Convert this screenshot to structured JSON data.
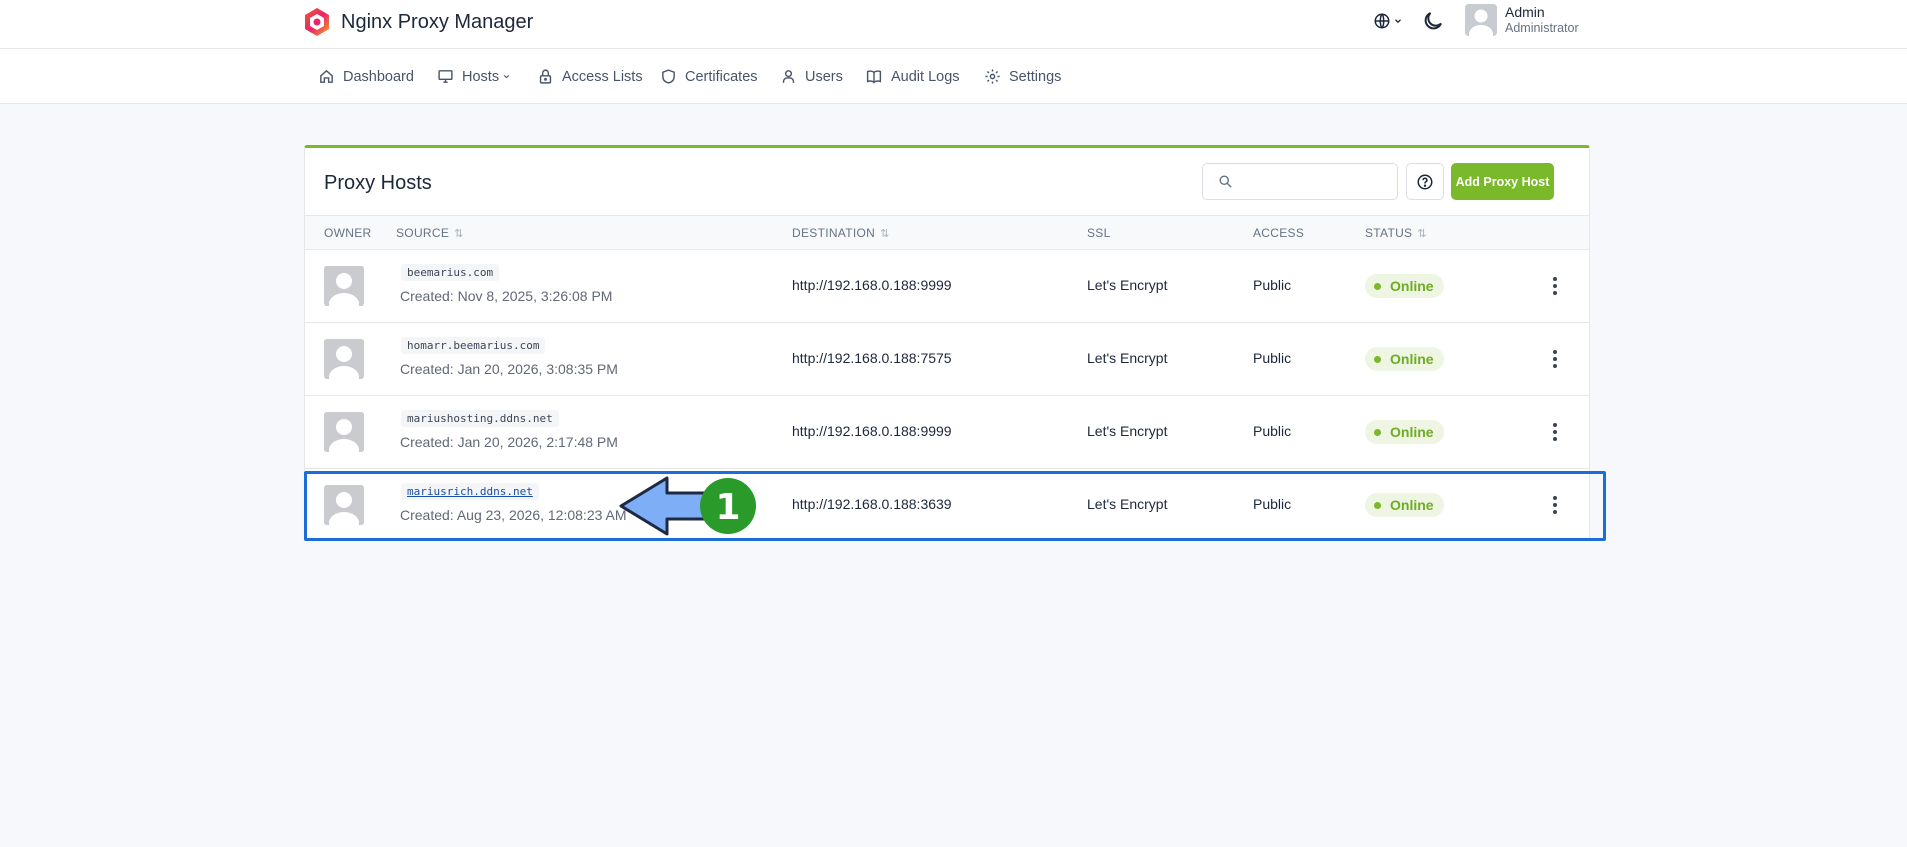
{
  "app": {
    "title": "Nginx Proxy Manager"
  },
  "user": {
    "name": "Admin",
    "role": "Administrator"
  },
  "nav": [
    {
      "label": "Dashboard",
      "icon": "home-icon"
    },
    {
      "label": "Hosts",
      "icon": "monitor-icon"
    },
    {
      "label": "Access Lists",
      "icon": "lock-icon"
    },
    {
      "label": "Certificates",
      "icon": "shield-icon"
    },
    {
      "label": "Users",
      "icon": "user-icon"
    },
    {
      "label": "Audit Logs",
      "icon": "book-icon"
    },
    {
      "label": "Settings",
      "icon": "gear-icon"
    }
  ],
  "card": {
    "title": "Proxy Hosts",
    "search_placeholder": "",
    "add_button": "Add Proxy Host"
  },
  "columns": {
    "owner": "OWNER",
    "source": "SOURCE",
    "destination": "DESTINATION",
    "ssl": "SSL",
    "access": "ACCESS",
    "status": "STATUS"
  },
  "rows": [
    {
      "domain": "beemarius.com",
      "created": "Created: Nov 8, 2025, 3:26:08 PM",
      "destination": "http://192.168.0.188:9999",
      "ssl": "Let's Encrypt",
      "access": "Public",
      "status": "Online"
    },
    {
      "domain": "homarr.beemarius.com",
      "created": "Created: Jan 20, 2026, 3:08:35 PM",
      "destination": "http://192.168.0.188:7575",
      "ssl": "Let's Encrypt",
      "access": "Public",
      "status": "Online"
    },
    {
      "domain": "mariushosting.ddns.net",
      "created": "Created: Jan 20, 2026, 2:17:48 PM",
      "destination": "http://192.168.0.188:9999",
      "ssl": "Let's Encrypt",
      "access": "Public",
      "status": "Online"
    },
    {
      "domain": "mariusrich.ddns.net",
      "created": "Created: Aug 23, 2026, 12:08:23 AM",
      "destination": "http://192.168.0.188:3639",
      "ssl": "Let's Encrypt",
      "access": "Public",
      "status": "Online"
    }
  ],
  "annotation": {
    "step_number": "1"
  },
  "colors": {
    "accent": "#7ab929",
    "highlight": "#1b6ed8",
    "arrow_fill": "#7eaef5",
    "badge_green": "#2a9a2a"
  }
}
